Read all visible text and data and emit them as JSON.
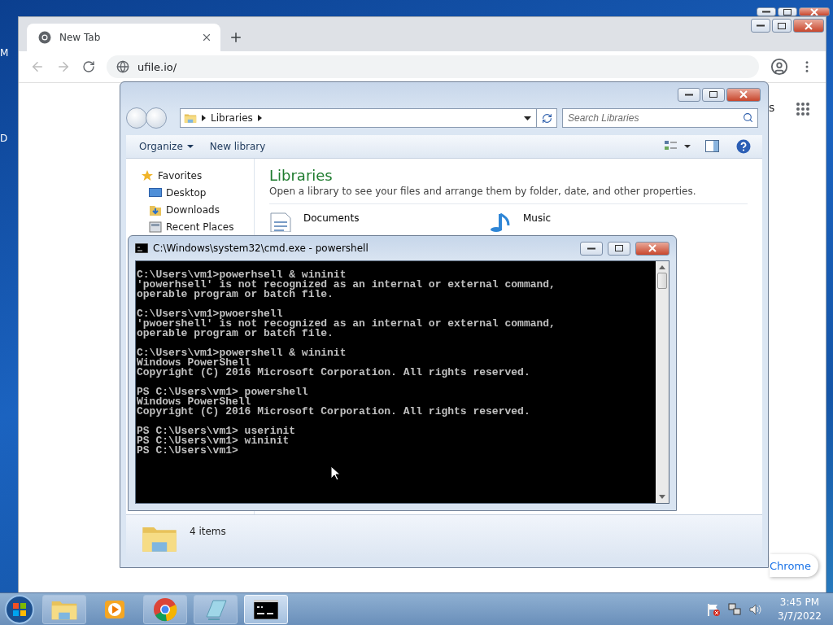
{
  "desktop": {
    "edge_labels": [
      "M",
      "D"
    ]
  },
  "browser": {
    "tabs": [
      {
        "label": "New Tab",
        "selected": true
      }
    ],
    "address": "ufile.io/",
    "page_fragment": "s",
    "customize_button": "Chrome"
  },
  "explorer": {
    "breadcrumb": [
      "Libraries"
    ],
    "search": {
      "placeholder": "Search Libraries"
    },
    "toolbar": [
      {
        "label": "Organize",
        "menu": true
      },
      {
        "label": "New library",
        "menu": false
      }
    ],
    "nav": [
      {
        "label": "Favorites",
        "kind": "favorites",
        "children": [
          {
            "label": "Desktop",
            "kind": "desktop"
          },
          {
            "label": "Downloads",
            "kind": "downloads"
          },
          {
            "label": "Recent Places",
            "kind": "recent"
          }
        ]
      }
    ],
    "heading": "Libraries",
    "description": "Open a library to see your files and arrange them by folder, date, and other properties.",
    "libraries": [
      {
        "name": "Documents",
        "kind": "documents"
      },
      {
        "name": "Music",
        "kind": "music"
      }
    ],
    "status": "4 items"
  },
  "console": {
    "title": "C:\\Windows\\system32\\cmd.exe - powershell",
    "blocks": [
      [
        "C:\\Users\\vm1>powerhsell & wininit",
        "'powerhsell' is not recognized as an internal or external command,",
        "operable program or batch file."
      ],
      [
        "C:\\Users\\vm1>pwoershell",
        "'pwoershell' is not recognized as an internal or external command,",
        "operable program or batch file."
      ],
      [
        "C:\\Users\\vm1>powershell & wininit",
        "Windows PowerShell",
        "Copyright (C) 2016 Microsoft Corporation. All rights reserved."
      ],
      [
        "PS C:\\Users\\vm1> powershell",
        "Windows PowerShell",
        "Copyright (C) 2016 Microsoft Corporation. All rights reserved."
      ],
      [
        "PS C:\\Users\\vm1> userinit",
        "PS C:\\Users\\vm1> wininit",
        "PS C:\\Users\\vm1>"
      ]
    ]
  },
  "taskbar": {
    "items": [
      {
        "kind": "explorer",
        "running": true,
        "selected": false
      },
      {
        "kind": "media",
        "running": false,
        "selected": false
      },
      {
        "kind": "chrome",
        "running": true,
        "selected": false
      },
      {
        "kind": "notepad",
        "running": true,
        "selected": false
      },
      {
        "kind": "console",
        "running": true,
        "selected": true
      }
    ],
    "time": "3:45 PM",
    "date": "3/7/2022"
  }
}
